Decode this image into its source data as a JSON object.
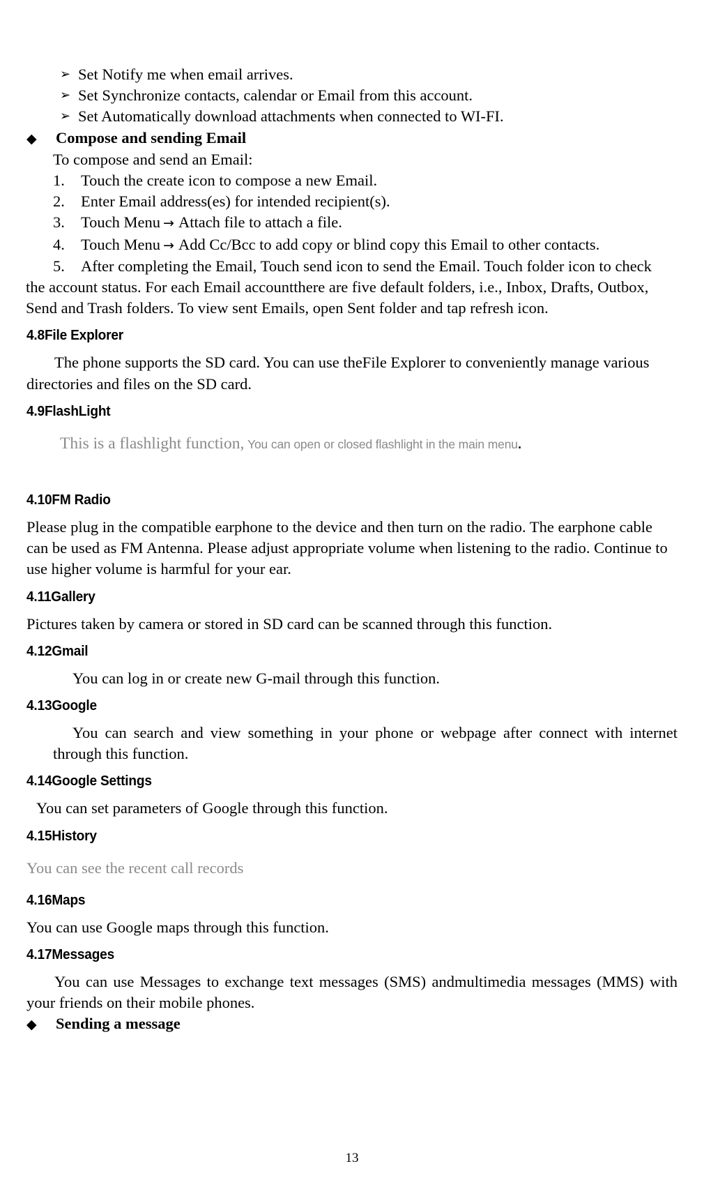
{
  "document": {
    "page_number": "13",
    "markers": {
      "arrow_bullet": "➢",
      "diamond_bullet": "◆",
      "inline_arrow": "→"
    }
  },
  "email_settings_bullets": [
    "Set Notify me when email arrives.",
    "Set Synchronize contacts, calendar or Email from this account.",
    "Set Automatically download attachments when connected to WI-FI."
  ],
  "compose_section": {
    "heading": "Compose and sending Email",
    "intro": "To compose and send an Email:",
    "steps": [
      {
        "number": "1.",
        "text": "Touch the create icon to compose a new Email."
      },
      {
        "number": "2.",
        "text": "Enter Email address(es) for intended recipient(s)."
      },
      {
        "number": "3.",
        "before_arrow": "Touch Menu",
        "after_arrow": "Attach file to attach a file."
      },
      {
        "number": "4.",
        "before_arrow": "Touch Menu",
        "after_arrow": "Add Cc/Bcc to add copy or blind copy this Email to other contacts."
      },
      {
        "number": "5.",
        "text": "After completing the Email, Touch send icon to send the Email. Touch folder icon to check"
      }
    ],
    "continuation": "the account status. For each Email accountthere are five default folders, i.e., Inbox, Drafts, Outbox, Send and Trash folders. To view sent Emails, open Sent folder and tap refresh icon."
  },
  "sections": [
    {
      "id": "file-explorer",
      "heading": "4.8File Explorer",
      "body": "The phone supports the SD card. You can use theFile Explorer to conveniently manage various directories and files on the SD card."
    },
    {
      "id": "flashlight",
      "heading": "4.9FlashLight",
      "body_serif": "This is a flashlight function",
      "body_comma": ",",
      "body_sans": "You can open or closed flashlight in the main menu",
      "body_period": "."
    },
    {
      "id": "fm-radio",
      "heading": "4.10FM Radio",
      "body": "Please plug in the compatible earphone to the device and then turn on the radio. The earphone cable can be used as FM Antenna. Please adjust appropriate volume when listening to the radio. Continue to use higher volume is harmful for your ear."
    },
    {
      "id": "gallery",
      "heading": "4.11Gallery",
      "body": "Pictures taken by camera or stored in SD card can be scanned through this function."
    },
    {
      "id": "gmail",
      "heading": "4.12Gmail",
      "body": "You can log in or create new G-mail through this function."
    },
    {
      "id": "google",
      "heading": "4.13Google",
      "body": "You can search and view something in your phone or webpage after connect with internet through this function."
    },
    {
      "id": "google-settings",
      "heading": "4.14Google Settings",
      "body": "You can set parameters of Google through this function."
    },
    {
      "id": "history",
      "heading": "4.15History",
      "body": "You can see the recent call records"
    },
    {
      "id": "maps",
      "heading": "4.16Maps",
      "body": "You can use Google maps through this function."
    },
    {
      "id": "messages",
      "heading": "4.17Messages",
      "body": "You can use Messages to exchange text messages (SMS) andmultimedia messages (MMS) with your friends on their mobile phones.",
      "sub_heading": "Sending a message"
    }
  ]
}
